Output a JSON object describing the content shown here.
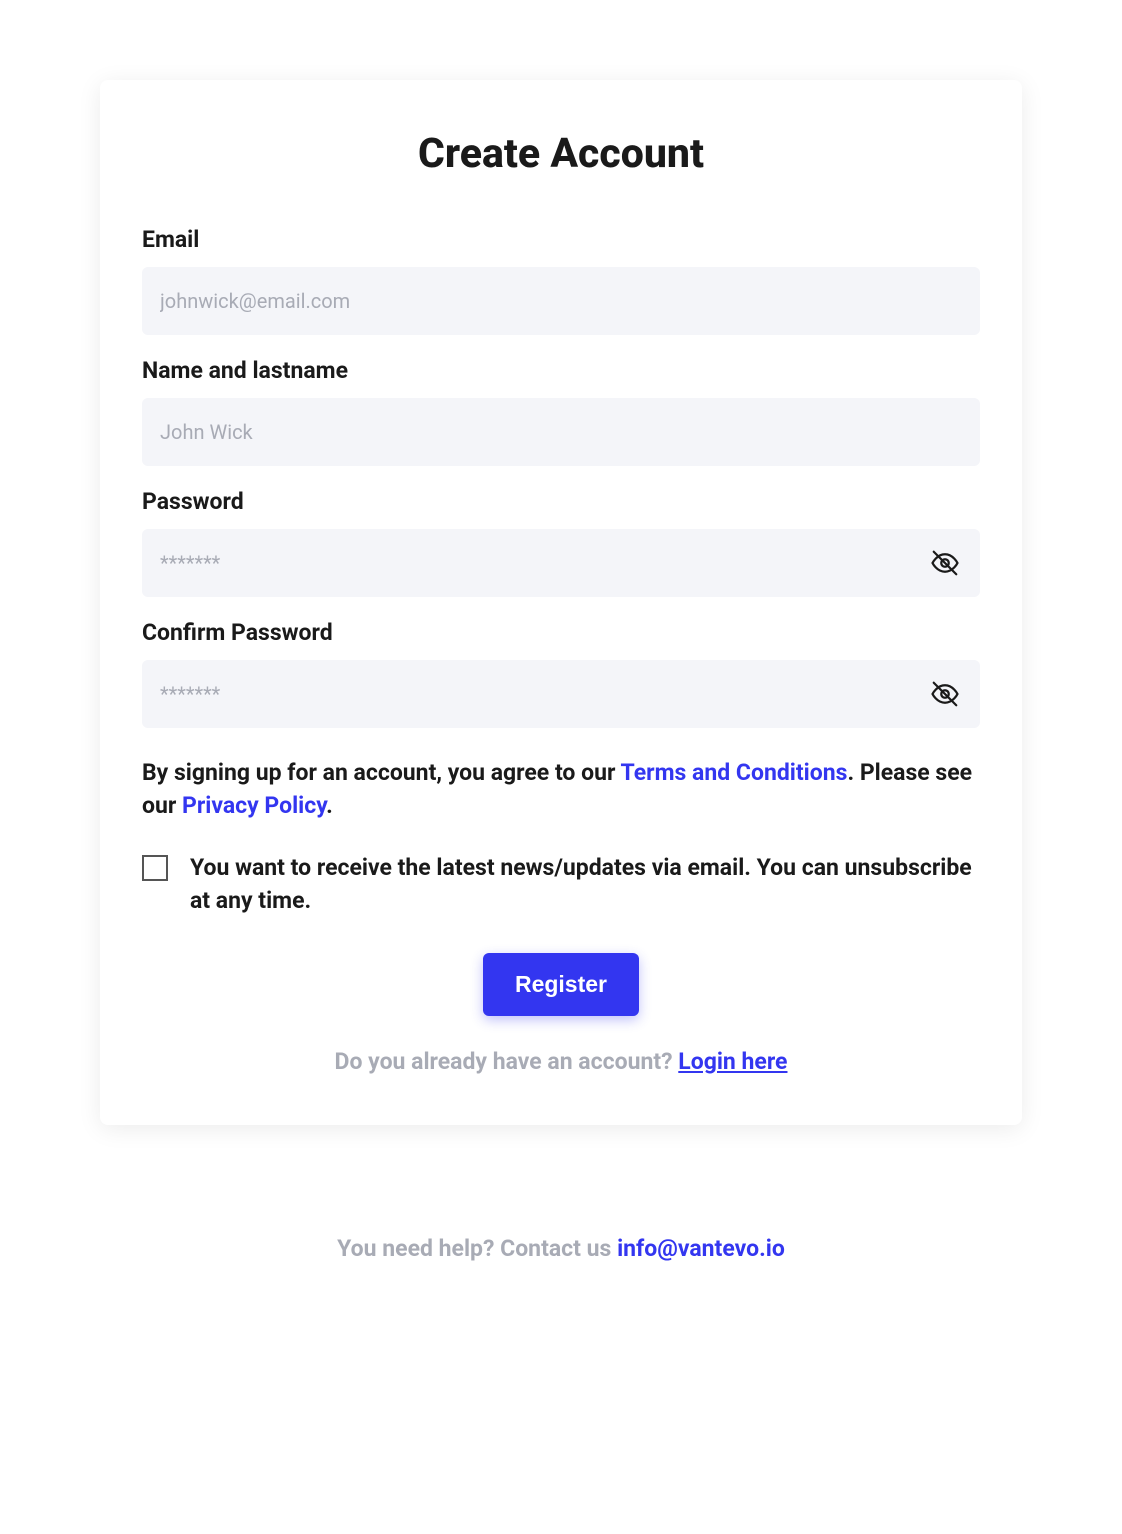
{
  "title": "Create Account",
  "fields": {
    "email": {
      "label": "Email",
      "placeholder": "johnwick@email.com"
    },
    "name": {
      "label": "Name and lastname",
      "placeholder": "John Wick"
    },
    "password": {
      "label": "Password",
      "placeholder": "*******"
    },
    "confirmPassword": {
      "label": "Confirm Password",
      "placeholder": "*******"
    }
  },
  "terms": {
    "prefix": "By signing up for an account, you agree to our ",
    "termsLink": "Terms and Conditions",
    "middle": ". Please see our ",
    "privacyLink": "Privacy Policy",
    "suffix": "."
  },
  "newsletter": {
    "label": "You want to receive the latest news/updates via email. You can unsubscribe at any time."
  },
  "registerButton": "Register",
  "loginPrompt": {
    "text": "Do you already have an account? ",
    "linkText": "Login here"
  },
  "footer": {
    "helpText": "You need help? Contact us ",
    "email": "info@vantevo.io"
  }
}
